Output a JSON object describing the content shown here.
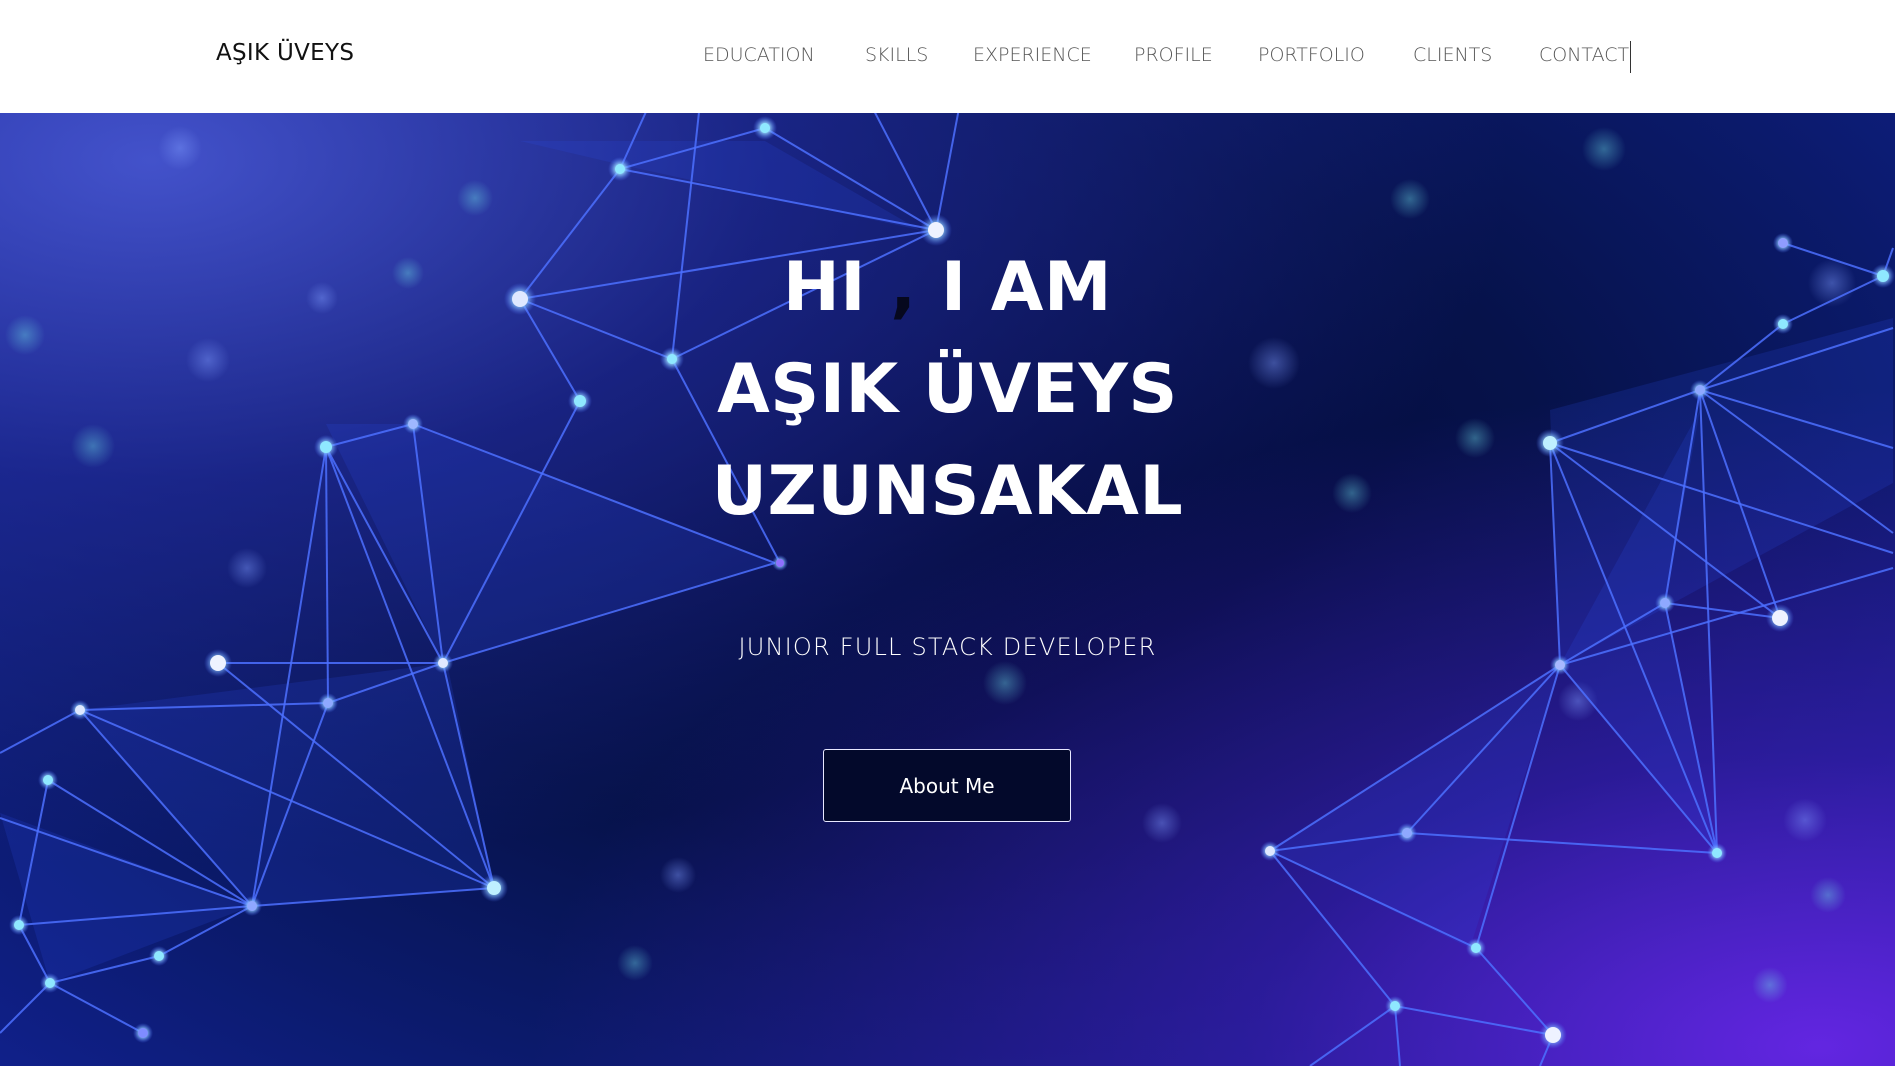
{
  "nav": {
    "brand": "AŞIK ÜVEYS",
    "links": [
      {
        "label": "EDUCATION"
      },
      {
        "label": "SKILLS"
      },
      {
        "label": "EXPERIENCE"
      },
      {
        "label": "PROFILE"
      },
      {
        "label": "PORTFOLIO"
      },
      {
        "label": "CLIENTS"
      },
      {
        "label": "CONTACT"
      }
    ]
  },
  "hero": {
    "greeting_hi": "HI",
    "greeting_comma": ",",
    "greeting_iam": "I AM",
    "name_line1": "AŞIK ÜVEYS",
    "name_line2": "UZUNSAKAL",
    "subtitle": "JUNIOR FULL STACK DEVELOPER",
    "button_label": "About Me"
  },
  "colors": {
    "nav_background": "#ffffff",
    "nav_text": "#555555",
    "brand_text": "#111111",
    "hero_dark": "#020836",
    "hero_blue": "#1a2fb0",
    "hero_violet": "#6a26e6",
    "network_line": "#4c70ff",
    "node_glow": "#7fd6ff",
    "button_background": "#03092b",
    "button_border": "#e8e8ff"
  }
}
